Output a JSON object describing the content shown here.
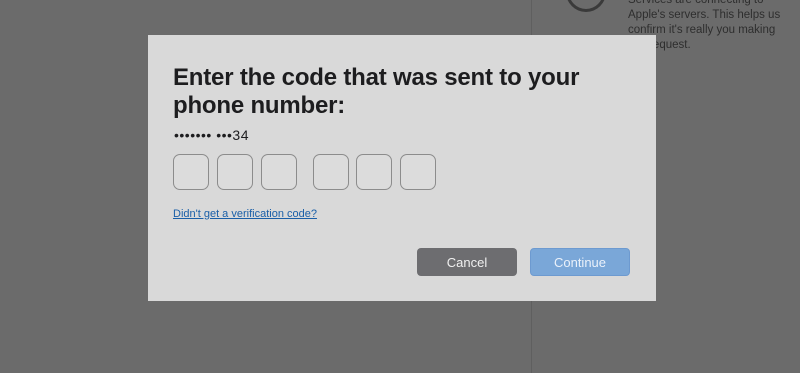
{
  "background": {
    "info_text": "Services are connecting to\nApple's servers. This helps us\nconfirm it's really you making\nthis request."
  },
  "dialog": {
    "title": "Enter the code that was sent to your phone number:",
    "masked_phone": "••••••• •••34",
    "code_digits": [
      "",
      "",
      "",
      "",
      "",
      ""
    ],
    "no_code_link": "Didn't get a verification code?",
    "cancel_label": "Cancel",
    "continue_label": "Continue"
  },
  "colors": {
    "modal_background": "#d9d9d9",
    "overlay": "#6b6b6b",
    "cancel_button": "#6d6d70",
    "continue_button_disabled": "#7aa7d8",
    "link": "#1a5fa8"
  }
}
